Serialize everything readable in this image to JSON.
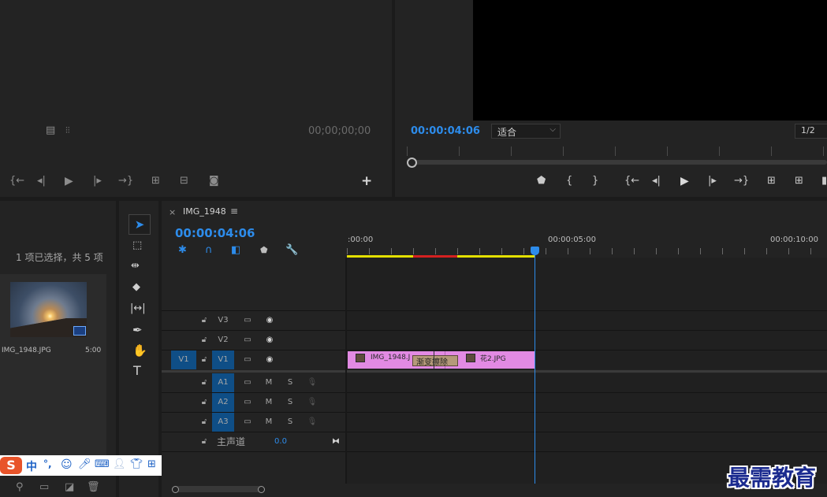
{
  "source_monitor": {
    "timecode": "00;00;00;00"
  },
  "program_monitor": {
    "timecode": "00:00:04:06",
    "fit_option": "适合",
    "resolution": "1/2"
  },
  "project": {
    "selection_info": "1 项已选择，共 5 项",
    "clip": {
      "name": "IMG_1948.JPG",
      "duration": "5:00"
    }
  },
  "timeline": {
    "tab_close": "×",
    "sequence_name": "IMG_1948",
    "menu_glyph": "≡",
    "timecode": "00:00:04:06",
    "ruler": [
      ":00:00",
      "00:00:05:00",
      "00:00:10:00"
    ],
    "tracks": {
      "v3": "V3",
      "v2": "V2",
      "v1": "V1",
      "v1_source": "V1",
      "a1": "A1",
      "a2": "A2",
      "a3": "A3",
      "mute": "M",
      "solo": "S",
      "master_label": "主声道",
      "master_value": "0.0"
    },
    "clips": [
      {
        "name": "IMG_1948.J",
        "color": "#e28ae3"
      },
      {
        "name": "花2.JPG",
        "color": "#e28ae3"
      }
    ],
    "transition": "渐变擦除"
  },
  "ime_toolbar": {
    "logo": "S",
    "lang": "中",
    "punct": "°,"
  },
  "watermark": "最需教育",
  "colors": {
    "accent": "#2d8ceb",
    "track_blue": "#0f4e86",
    "clip_pink": "#e28ae3",
    "work_yellow": "#e4e000",
    "render_red": "#d42020"
  }
}
